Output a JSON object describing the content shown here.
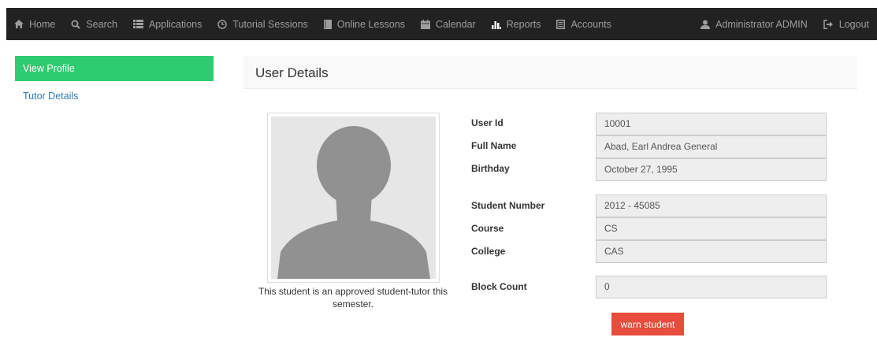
{
  "nav": {
    "home": "Home",
    "search": "Search",
    "applications": "Applications",
    "tutorial_sessions": "Tutorial Sessions",
    "online_lessons": "Online Lessons",
    "calendar": "Calendar",
    "reports": "Reports",
    "accounts": "Accounts",
    "user": "Administrator ADMIN",
    "logout": "Logout"
  },
  "sidebar": {
    "items": [
      {
        "label": "View Profile",
        "active": true
      },
      {
        "label": "Tutor Details",
        "active": false
      }
    ]
  },
  "panel": {
    "title": "User Details",
    "caption": "This student is an approved student-tutor this semester."
  },
  "fields": {
    "user_id": {
      "label": "User Id",
      "value": "10001"
    },
    "full_name": {
      "label": "Full Name",
      "value": "Abad, Earl Andrea General"
    },
    "birthday": {
      "label": "Birthday",
      "value": "October 27, 1995"
    },
    "student_number": {
      "label": "Student Number",
      "value": "2012 - 45085"
    },
    "course": {
      "label": "Course",
      "value": "CS"
    },
    "college": {
      "label": "College",
      "value": "CAS"
    },
    "block_count": {
      "label": "Block Count",
      "value": "0"
    }
  },
  "actions": {
    "warn_label": "warn student"
  },
  "colors": {
    "navbar_bg": "#222222",
    "active_sidebar": "#2ecc71",
    "warn_button": "#e74c3c",
    "link": "#337ab7"
  },
  "icons": [
    "home-icon",
    "search-icon",
    "list-icon",
    "clock-icon",
    "book-icon",
    "calendar-icon",
    "bar-chart-icon",
    "accounts-icon",
    "user-icon",
    "logout-icon",
    "avatar-silhouette"
  ]
}
